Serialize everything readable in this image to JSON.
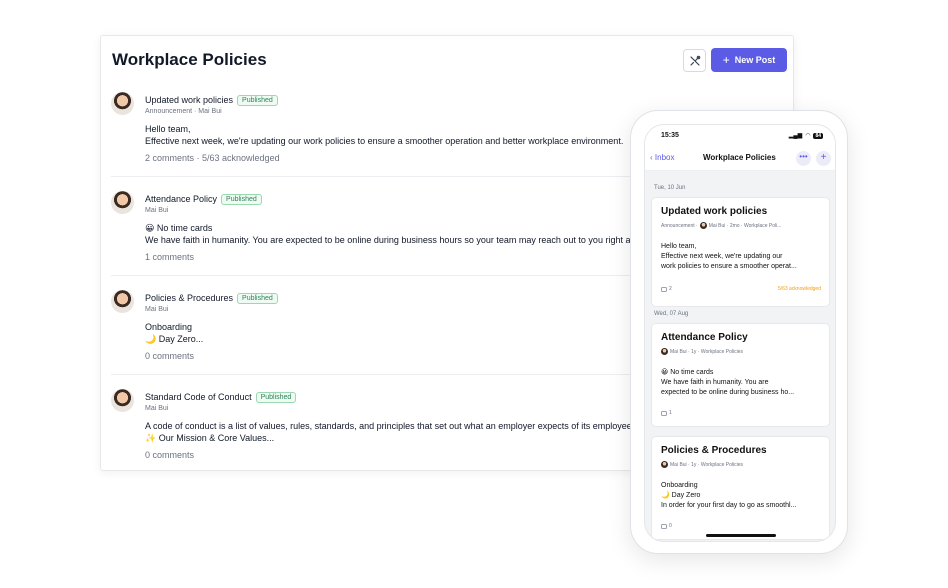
{
  "desktop": {
    "title": "Workplace Policies",
    "new_post_label": "New Post",
    "tools_icon": "tools-icon",
    "posts": [
      {
        "title": "Updated work policies",
        "status": "Published",
        "meta": "Announcement · Mai Bui",
        "body": [
          "Hello team,",
          "Effective next week, we're updating our work policies to ensure a smoother operation and better workplace environment."
        ],
        "footer": "2 comments · 5/63 acknowledged"
      },
      {
        "title": "Attendance Policy",
        "status": "Published",
        "meta": "Mai Bui",
        "body": [
          "😀 No time cards",
          "We have faith in humanity. You are expected to be online during business hours so your team may reach out to you right away."
        ],
        "footer": "1 comments"
      },
      {
        "title": "Policies & Procedures",
        "status": "Published",
        "meta": "Mai Bui",
        "body": [
          "Onboarding",
          "🌙 Day Zero..."
        ],
        "footer": "0 comments"
      },
      {
        "title": "Standard Code of Conduct",
        "status": "Published",
        "meta": "Mai Bui",
        "body": [
          "A code of conduct is a list of values, rules, standards, and principles that set out what an employer expects of its employees.",
          "✨ Our Mission & Core Values..."
        ],
        "footer": "0 comments"
      }
    ]
  },
  "phone": {
    "time": "15:35",
    "battery": "84",
    "back_label": "Inbox",
    "title": "Workplace Policies",
    "more_icon": "ellipsis-icon",
    "plus_icon": "plus-icon",
    "groups": [
      {
        "date": "Tue, 10 Jun",
        "card": {
          "title": "Updated work policies",
          "meta_prefix": "Announcement ·",
          "meta_suffix": "Mai Bui · 2mo · Workplace Poli...",
          "body": [
            "Hello team,",
            "Effective next week, we're updating our",
            "work policies to ensure a smoother operat..."
          ],
          "comments": "2",
          "ack": "5/63 acknowledged"
        }
      },
      {
        "date": "Wed, 07 Aug",
        "card": {
          "title": "Attendance Policy",
          "meta": "Mai Bui · 1y · Workplace Policies",
          "body": [
            "😀 No time cards",
            "We have faith in humanity. You are",
            "expected to be online during business ho..."
          ],
          "comments": "1"
        }
      },
      {
        "card": {
          "title": "Policies & Procedures",
          "meta": "Mai Bui · 1y · Workplace Policies",
          "body": [
            "Onboarding",
            "🌙 Day Zero",
            "In order for your first day to go as smoothl..."
          ],
          "comments": "0"
        }
      }
    ]
  }
}
